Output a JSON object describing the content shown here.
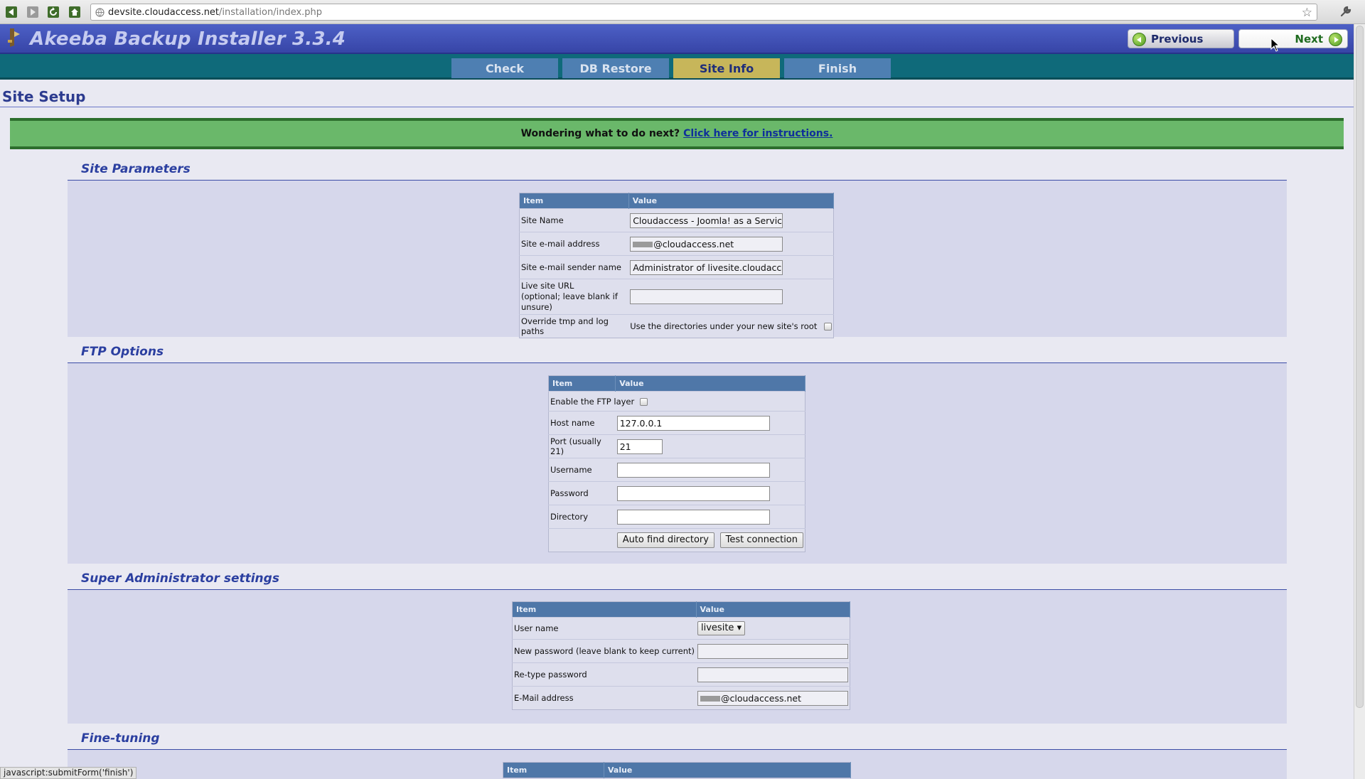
{
  "browser": {
    "url_host": "devsite.cloudaccess.net",
    "url_path": "/installation/index.php",
    "star_glyph": "☆"
  },
  "header": {
    "title": "Akeeba Backup Installer 3.3.4",
    "previous_label": "Previous",
    "next_label": "Next"
  },
  "tabs": [
    {
      "label": "Check",
      "active": false
    },
    {
      "label": "DB Restore",
      "active": false
    },
    {
      "label": "Site Info",
      "active": true
    },
    {
      "label": "Finish",
      "active": false
    }
  ],
  "page": {
    "title": "Site Setup",
    "notice_text": "Wondering what to do next?",
    "notice_link": "Click here for instructions."
  },
  "site_parameters": {
    "heading": "Site Parameters",
    "col_item": "Item",
    "col_value": "Value",
    "site_name_label": "Site Name",
    "site_name_value": "Cloudaccess - Joomla! as a Service",
    "site_email_label": "Site e-mail address",
    "site_email_value": "@cloudaccess.net",
    "sender_name_label": "Site e-mail sender name",
    "sender_name_value": "Administrator of livesite.cloudaccess",
    "live_url_label_1": "Live site URL",
    "live_url_label_2": "(optional; leave blank if unsure)",
    "live_url_value": "",
    "override_label": "Override tmp and log paths",
    "override_value": "Use the directories under your new site's root"
  },
  "ftp_options": {
    "heading": "FTP Options",
    "col_item": "Item",
    "col_value": "Value",
    "enable_label": "Enable the FTP layer",
    "host_label": "Host name",
    "host_value": "127.0.0.1",
    "port_label": "Port (usually 21)",
    "port_value": "21",
    "username_label": "Username",
    "password_label": "Password",
    "directory_label": "Directory",
    "auto_find_label": "Auto find directory",
    "test_connection_label": "Test connection"
  },
  "super_admin": {
    "heading": "Super Administrator settings",
    "col_item": "Item",
    "col_value": "Value",
    "user_name_label": "User name",
    "user_name_value": "livesite",
    "new_password_label": "New password (leave blank to keep current)",
    "retype_label": "Re-type password",
    "email_label": "E-Mail address",
    "email_value": "@cloudaccess.net"
  },
  "fine_tuning": {
    "heading": "Fine-tuning",
    "col_item": "Item",
    "col_value": "Value"
  },
  "status_bar": "javascript:submitForm('finish')",
  "colors": {
    "header_blue": "#3d4db3",
    "tab_active": "#c7b65a",
    "notice_green": "#6ab86a",
    "table_header": "#4f77a8"
  }
}
